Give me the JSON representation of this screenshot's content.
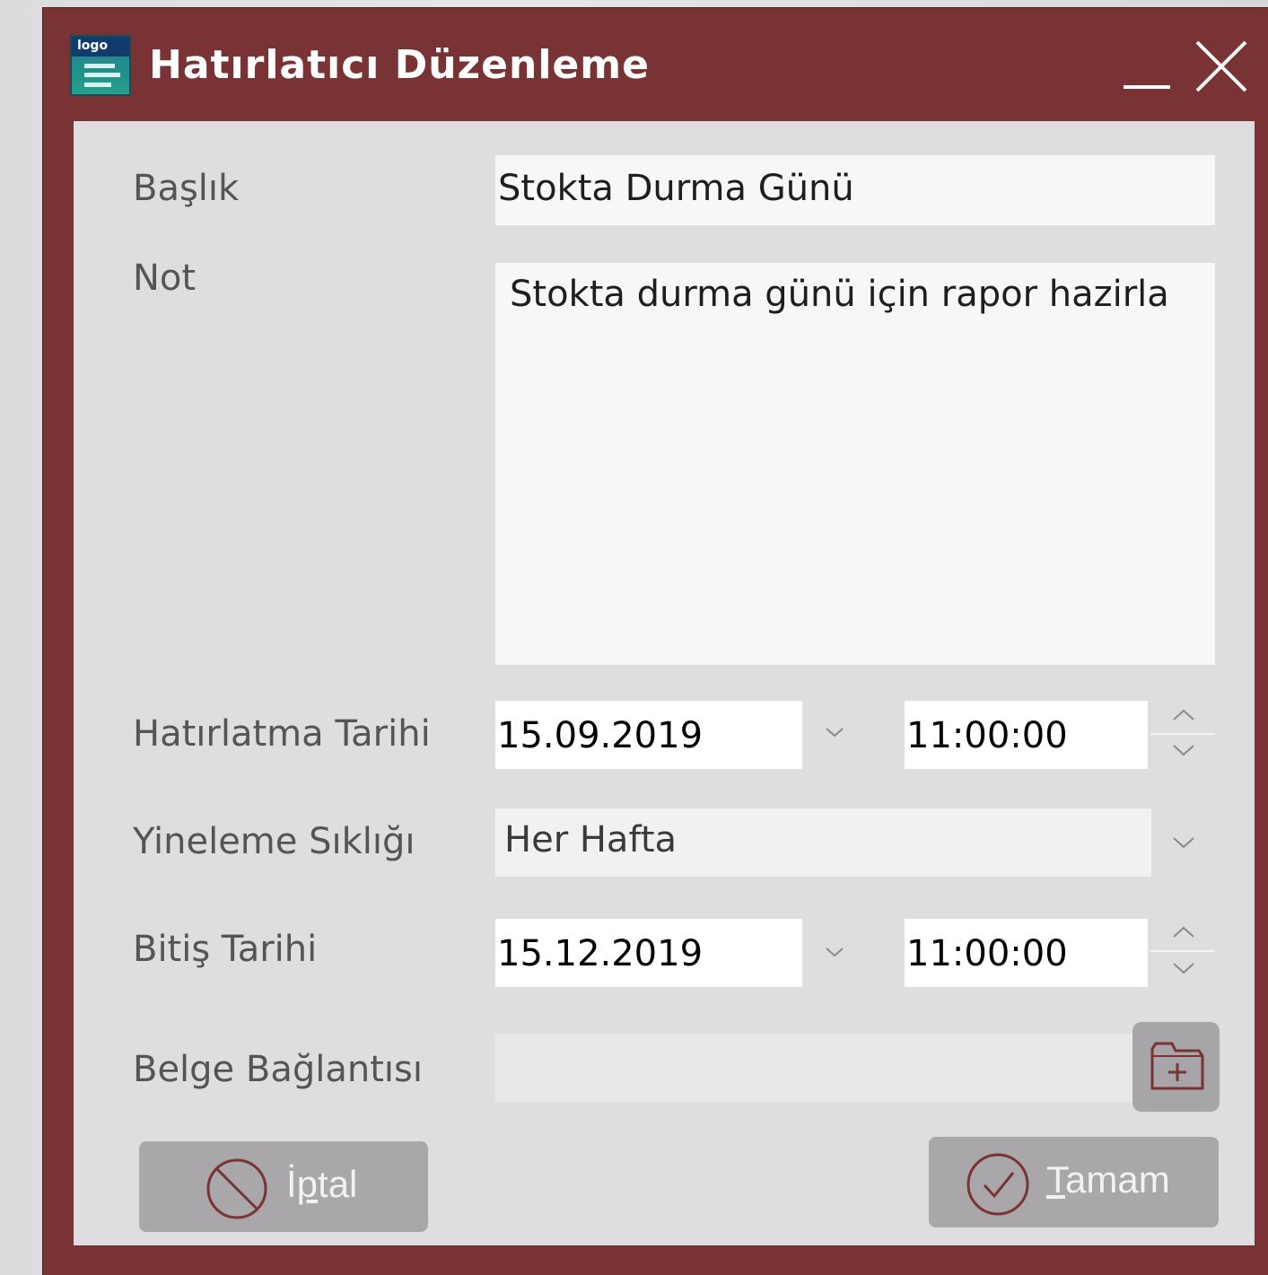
{
  "window": {
    "title": "Hatırlatıcı Düzenleme",
    "app_icon_label": "logo"
  },
  "form": {
    "title_label": "Başlık",
    "title_value": "Stokta Durma Günü",
    "note_label": "Not",
    "note_value": "Stokta durma günü için rapor hazirla",
    "reminder_date_label": "Hatırlatma Tarihi",
    "reminder_date_value": "15.09.2019",
    "reminder_time_value": "11:00:00",
    "frequency_label": "Yineleme Sıklığı",
    "frequency_value": "Her Hafta",
    "end_date_label": "Bitiş Tarihi",
    "end_date_value": "15.12.2019",
    "end_time_value": "11:00:00",
    "doc_link_label": "Belge Bağlantısı",
    "doc_link_value": ""
  },
  "buttons": {
    "cancel_mnemonic": "İ",
    "cancel_underlined": "p",
    "cancel_rest": "tal",
    "ok_underlined": "T",
    "ok_rest": "amam"
  },
  "colors": {
    "window_frame": "#7a3334",
    "panel_bg": "#dedddf",
    "button_bg": "#a9a7a9",
    "icon_accent": "#7a3334"
  },
  "icons": {
    "minimize": "minimize-icon",
    "close": "close-icon",
    "dropdown": "chevron-down-icon",
    "spin_up": "chevron-up-icon",
    "folder_add": "folder-add-icon",
    "cancel": "prohibited-icon",
    "ok": "check-circle-icon"
  }
}
